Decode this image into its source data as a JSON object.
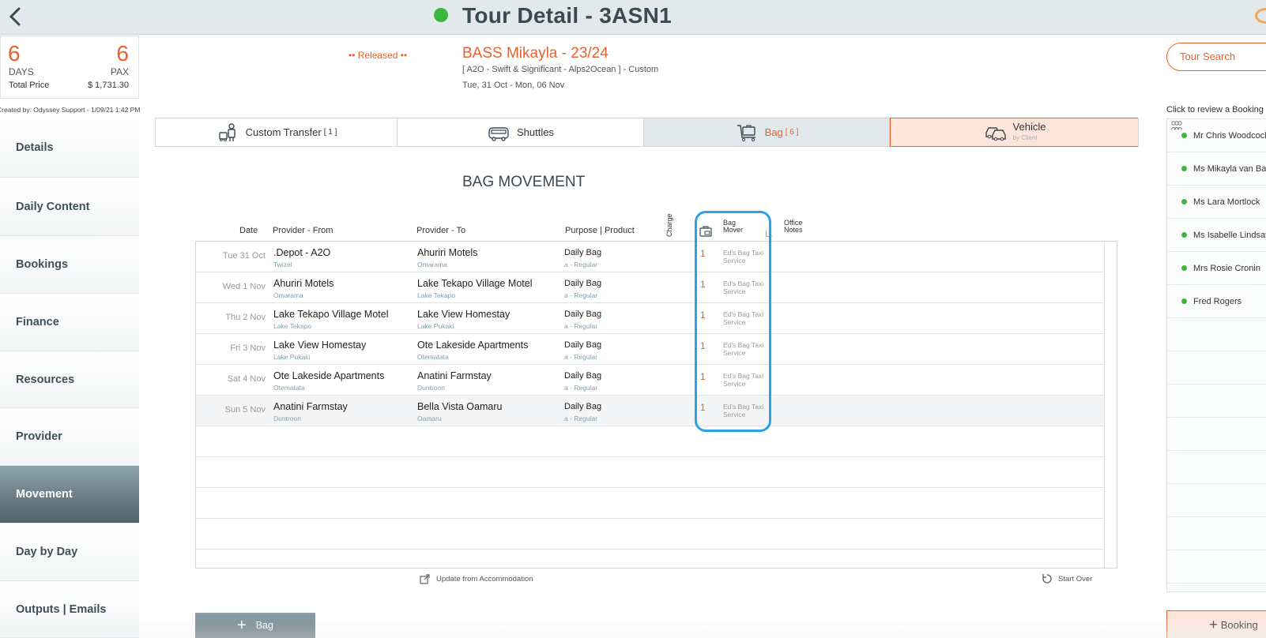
{
  "header": {
    "title": "Tour Detail - 3ASN1",
    "status_color": "#3cb63c"
  },
  "summary": {
    "days_value": "6",
    "days_label": "DAYS",
    "pax_value": "6",
    "pax_label": "PAX",
    "total_price_label": "Total Price",
    "total_price_value": "$ 1,731.30",
    "created_by": "Created by: Odyssey Support - 1/09/21 1:42 PM"
  },
  "nav": {
    "items": [
      {
        "label": "Details"
      },
      {
        "label": "Daily Content"
      },
      {
        "label": "Bookings"
      },
      {
        "label": "Finance"
      },
      {
        "label": "Resources"
      },
      {
        "label": "Provider"
      },
      {
        "label": "Movement"
      },
      {
        "label": "Day by Day"
      },
      {
        "label": "Outputs | Emails"
      }
    ],
    "active": "Movement"
  },
  "tour": {
    "status": "•• Released ••",
    "name": "BASS Mikayla - 23/24",
    "subtitle": "[ A2O - Swift & Significant - Alps2Ocean ] - Custom",
    "dates": "Tue, 31 Oct  - Mon, 06 Nov"
  },
  "right_panel": {
    "tour_search": "Tour Search",
    "review_label": "Click to review a Booking",
    "passengers": [
      "Mr Chris Woodcock",
      "Ms Mikayla van Ba",
      "Ms Lara Mortlock",
      "Ms Isabelle Lindsay",
      "Mrs Rosie Cronin",
      "Fred Rogers"
    ],
    "booking_button": "Booking"
  },
  "tabs": {
    "custom_transfer": {
      "label": "Custom Transfer",
      "count": "[ 1 ]"
    },
    "shuttles": {
      "label": "Shuttles"
    },
    "bag": {
      "label": "Bag",
      "count": "[ 6 ]"
    },
    "vehicle": {
      "label": "Vehicle",
      "sub": "by Client"
    }
  },
  "section": {
    "title": "BAG MOVEMENT"
  },
  "table": {
    "headers": {
      "date": "Date",
      "from": "Provider - From",
      "to": "Provider - To",
      "purpose": "Purpose | Product",
      "charge": "Charge",
      "mover_line1": "Bag",
      "mover_line2": "Mover",
      "notes_line1": "Office",
      "notes_line2": "Notes"
    },
    "rows": [
      {
        "date": "Tue 31 Oct",
        "from": ".Depot - A2O",
        "from_loc": "Twizel",
        "to": "Ahuriri Motels",
        "to_loc": "Omarama",
        "purpose": "Daily Bag",
        "product": "a - Regular",
        "qty": "1",
        "mover": "Ed's Bag Taxi Service"
      },
      {
        "date": "Wed 1 Nov",
        "from": "Ahuriri Motels",
        "from_loc": "Omarama",
        "to": "Lake Tekapo Village Motel",
        "to_loc": "Lake Tekapo",
        "purpose": "Daily Bag",
        "product": "a - Regular",
        "qty": "1",
        "mover": "Ed's Bag Taxi Service"
      },
      {
        "date": "Thu 2 Nov",
        "from": "Lake Tekapo Village Motel",
        "from_loc": "Lake Tekapo",
        "to": "Lake View Homestay",
        "to_loc": "Lake Pukaki",
        "purpose": "Daily Bag",
        "product": "a - Regular",
        "qty": "1",
        "mover": "Ed's Bag Taxi Service"
      },
      {
        "date": "Fri 3 Nov",
        "from": "Lake View Homestay",
        "from_loc": "Lake Pukaki",
        "to": "Ote Lakeside Apartments",
        "to_loc": "Otematata",
        "purpose": "Daily Bag",
        "product": "a - Regular",
        "qty": "1",
        "mover": "Ed's Bag Taxi Service"
      },
      {
        "date": "Sat 4 Nov",
        "from": "Ote Lakeside Apartments",
        "from_loc": "Otematata",
        "to": "Anatini Farmstay",
        "to_loc": "Duntroon",
        "purpose": "Daily Bag",
        "product": "a - Regular",
        "qty": "1",
        "mover": "Ed's Bag Taxi Service"
      },
      {
        "date": "Sun 5 Nov",
        "from": "Anatini Farmstay",
        "from_loc": "Duntroon",
        "to": "Bella Vista Oamaru",
        "to_loc": "Oamaru",
        "purpose": "Daily Bag",
        "product": "a - Regular",
        "qty": "1",
        "mover": "Ed's Bag Taxi Service"
      }
    ]
  },
  "actions": {
    "update": "Update from Accommodation",
    "start_over": "Start Over",
    "add_bag": "Bag"
  },
  "colors": {
    "accent": "#e8612c",
    "highlight": "#2aa2e6",
    "nav_active": "#4f6169"
  }
}
